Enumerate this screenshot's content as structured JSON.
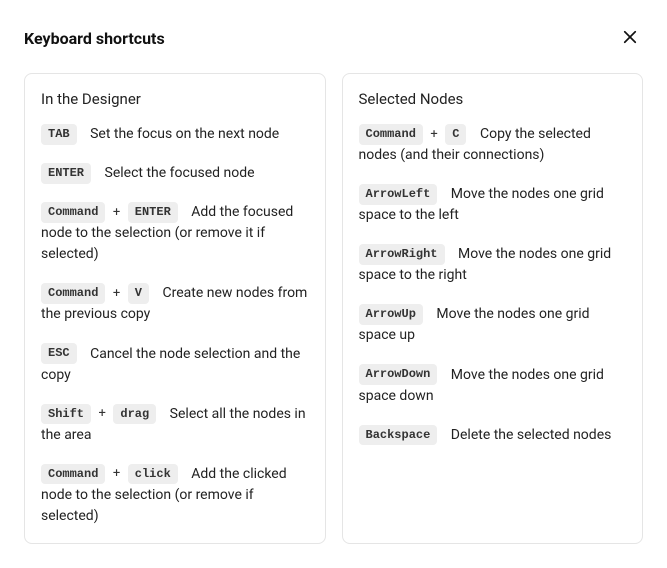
{
  "title": "Keyboard shortcuts",
  "plus": "+",
  "sections": [
    {
      "title": "In the Designer",
      "shortcuts": [
        {
          "keys": [
            "TAB"
          ],
          "desc": "Set the focus on the next node"
        },
        {
          "keys": [
            "ENTER"
          ],
          "desc": "Select the focused node"
        },
        {
          "keys": [
            "Command",
            "ENTER"
          ],
          "desc": "Add the focused node to the selection (or remove it if selected)"
        },
        {
          "keys": [
            "Command",
            "V"
          ],
          "desc": "Create new nodes from the previous copy"
        },
        {
          "keys": [
            "ESC"
          ],
          "desc": "Cancel the node selection and the copy"
        },
        {
          "keys": [
            "Shift",
            "drag"
          ],
          "desc": "Select all the nodes in the area"
        },
        {
          "keys": [
            "Command",
            "click"
          ],
          "desc": "Add the clicked node to the selection (or remove if selected)"
        }
      ]
    },
    {
      "title": "Selected Nodes",
      "shortcuts": [
        {
          "keys": [
            "Command",
            "C"
          ],
          "desc": "Copy the selected nodes (and their connections)"
        },
        {
          "keys": [
            "ArrowLeft"
          ],
          "desc": "Move the nodes one grid space to the left"
        },
        {
          "keys": [
            "ArrowRight"
          ],
          "desc": "Move the nodes one grid space to the right"
        },
        {
          "keys": [
            "ArrowUp"
          ],
          "desc": "Move the nodes one grid space up"
        },
        {
          "keys": [
            "ArrowDown"
          ],
          "desc": "Move the nodes one grid space down"
        },
        {
          "keys": [
            "Backspace"
          ],
          "desc": "Delete the selected nodes"
        }
      ]
    }
  ]
}
